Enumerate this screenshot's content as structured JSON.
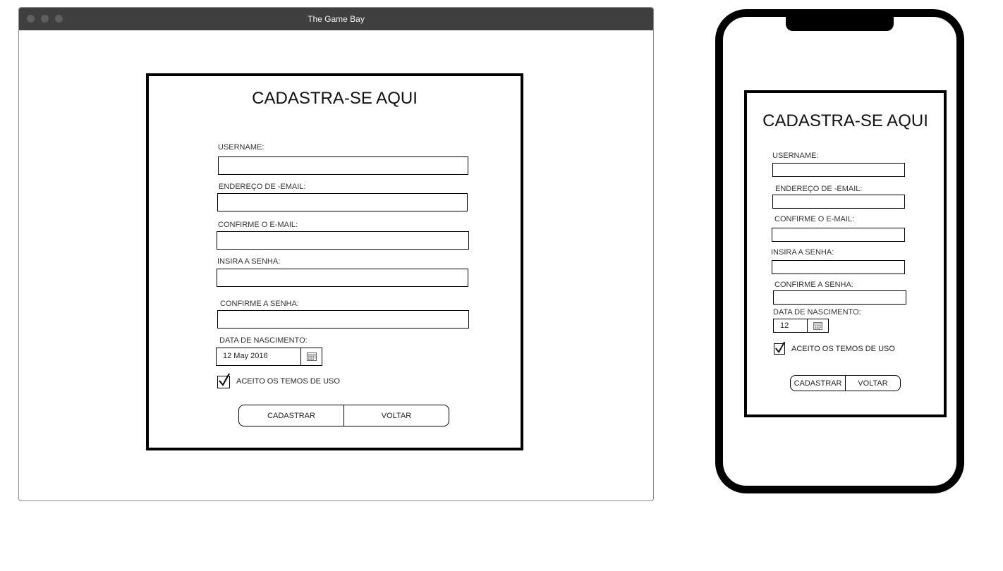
{
  "window": {
    "title": "The Game Bay"
  },
  "desktop_form": {
    "heading": "CADASTRA-SE AQUI",
    "labels": {
      "username": "USERNAME:",
      "email": "ENDEREÇO DE -EMAIL:",
      "confirm_email": "CONFIRME O E-MAIL:",
      "password": "INSIRA A SENHA:",
      "confirm_password": "CONFIRME A SENHA:",
      "birthdate": "DATA DE NASCIMENTO:"
    },
    "birthdate_value": "12 May 2016",
    "terms_label": "ACEITO OS TEMOS DE USO",
    "terms_checked": true,
    "register_button": "CADASTRAR",
    "back_button": "VOLTAR"
  },
  "mobile_form": {
    "heading": "CADASTRA-SE AQUI",
    "labels": {
      "username": "USERNAME:",
      "email": "ENDEREÇO DE -EMAIL:",
      "confirm_email": "CONFIRME O E-MAIL:",
      "password": "INSIRA A SENHA:",
      "confirm_password": "CONFIRME A SENHA:",
      "birthdate": "DATA DE NASCIMENTO:"
    },
    "birthdate_value": "12",
    "terms_label": "ACEITO OS TEMOS DE USO",
    "terms_checked": true,
    "register_button": "CADASTRAR",
    "back_button": "VOLTAR"
  }
}
